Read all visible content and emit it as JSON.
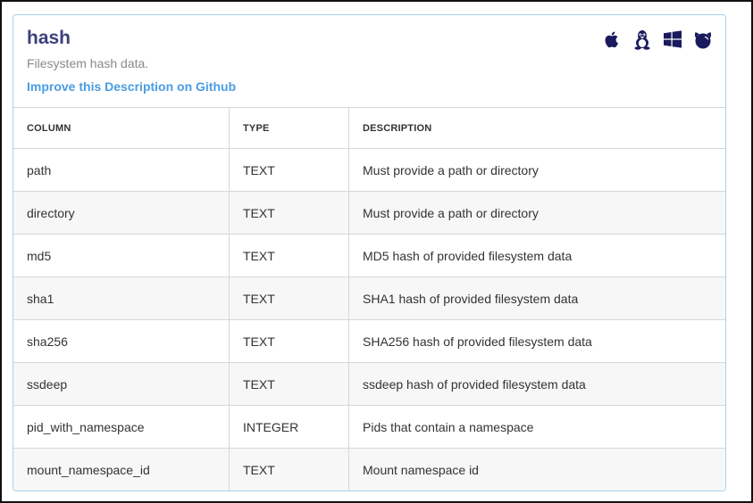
{
  "table_meta": {
    "name": "hash",
    "description": "Filesystem hash data.",
    "improve_link": "Improve this Description on Github"
  },
  "platforms": [
    {
      "name": "apple-icon",
      "color": "#1a1a5e"
    },
    {
      "name": "linux-icon",
      "color": "#1a1a5e"
    },
    {
      "name": "windows-icon",
      "color": "#1a1a5e"
    },
    {
      "name": "freebsd-icon",
      "color": "#1a1a5e"
    }
  ],
  "columns_table": {
    "headers": [
      "COLUMN",
      "TYPE",
      "DESCRIPTION"
    ],
    "rows": [
      [
        "path",
        "TEXT",
        "Must provide a path or directory"
      ],
      [
        "directory",
        "TEXT",
        "Must provide a path or directory"
      ],
      [
        "md5",
        "TEXT",
        "MD5 hash of provided filesystem data"
      ],
      [
        "sha1",
        "TEXT",
        "SHA1 hash of provided filesystem data"
      ],
      [
        "sha256",
        "TEXT",
        "SHA256 hash of provided filesystem data"
      ],
      [
        "ssdeep",
        "TEXT",
        "ssdeep hash of provided filesystem data"
      ],
      [
        "pid_with_namespace",
        "INTEGER",
        "Pids that contain a namespace"
      ],
      [
        "mount_namespace_id",
        "TEXT",
        "Mount namespace id"
      ]
    ]
  },
  "colors": {
    "title": "#3c3f7d",
    "link": "#4a9ce3",
    "card_border": "#a9d4ea",
    "icon": "#1a1a5e",
    "alt_row": "#f7f7f7"
  }
}
